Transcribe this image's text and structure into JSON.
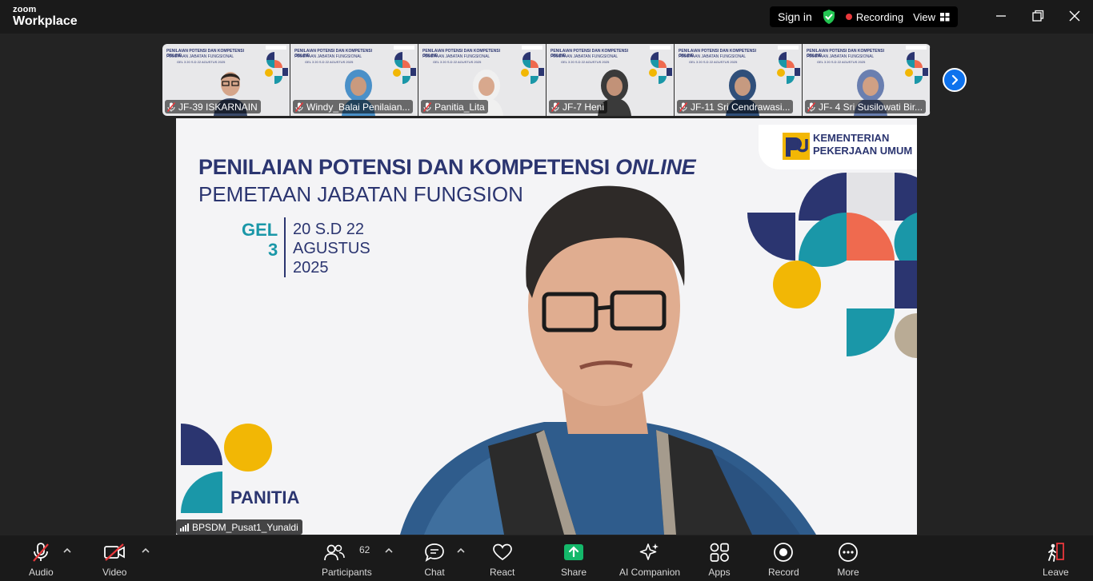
{
  "window": {
    "logo_top": "zoom",
    "logo_bottom": "Workplace",
    "sign_in": "Sign in",
    "recording": "Recording",
    "view": "View"
  },
  "thumbnails": [
    {
      "name": "JF-39 ISKARNAIN"
    },
    {
      "name": "Windy_Balai Penilaian..."
    },
    {
      "name": "Panitia_Lita"
    },
    {
      "name": "JF-7 Heni"
    },
    {
      "name": "JF-11 Sri Cendrawasi..."
    },
    {
      "name": "JF- 4 Sri Susilowati Bir..."
    }
  ],
  "thumb_slide": {
    "title": "PENILAIAN POTENSI DAN KOMPETENSI ONLINE",
    "sub": "PEMETAAN JABATAN FUNGSIONAL",
    "gel": "GEL 3  20 S.D 22 AGUSTUS 2025"
  },
  "slide": {
    "title_main": "PENILAIAN POTENSI DAN KOMPETENSI ",
    "title_italic": "ONLINE",
    "subtitle": "PEMETAAN JABATAN FUNGSION",
    "gel_label": "GEL",
    "gel_number": "3",
    "date_line1": "20 S.D 22",
    "date_line2": "AGUSTUS",
    "date_line3": "2025",
    "ministry_line1": "KEMENTERIAN",
    "ministry_line2": "PEKERJAAN UMUM",
    "panitia": "PANITIA"
  },
  "speaker": {
    "name": "BPSDM_Pusat1_Yunaldi"
  },
  "toolbar": {
    "audio": "Audio",
    "video": "Video",
    "participants": "Participants",
    "participants_count": "62",
    "chat": "Chat",
    "react": "React",
    "share": "Share",
    "ai_companion": "AI Companion",
    "apps": "Apps",
    "record": "Record",
    "more": "More",
    "leave": "Leave"
  },
  "colors": {
    "navy": "#2b3570",
    "teal": "#1a97a8",
    "yellow": "#f2b705",
    "coral": "#ef6a4f",
    "share_green": "#14b86a",
    "zoom_blue": "#0e72ed",
    "recording_red": "#e8383b"
  },
  "icons": [
    "shield-check-icon",
    "recording-dot-icon",
    "view-grid-icon",
    "minimize-icon",
    "restore-icon",
    "close-icon",
    "muted-mic-icon",
    "video-off-icon",
    "participants-icon",
    "chat-icon",
    "react-heart-icon",
    "share-arrow-icon",
    "sparkle-icon",
    "apps-icon",
    "record-icon",
    "more-dots-icon",
    "leave-icon",
    "chevron-right-icon",
    "signal-bars-icon"
  ]
}
